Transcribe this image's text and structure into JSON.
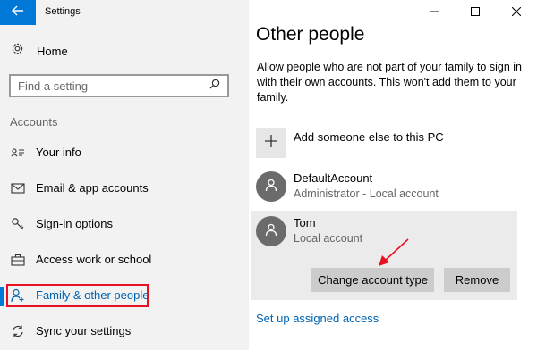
{
  "window": {
    "title": "Settings",
    "accent": "#0078d7",
    "highlight_color": "#e81123"
  },
  "sidebar": {
    "home_label": "Home",
    "search_placeholder": "Find a setting",
    "section_label": "Accounts",
    "items": [
      {
        "label": "Your info",
        "icon": "person-card-icon"
      },
      {
        "label": "Email & app accounts",
        "icon": "envelope-icon"
      },
      {
        "label": "Sign-in options",
        "icon": "key-icon"
      },
      {
        "label": "Access work or school",
        "icon": "briefcase-icon"
      },
      {
        "label": "Family & other people",
        "icon": "person-add-icon",
        "active": true
      },
      {
        "label": "Sync your settings",
        "icon": "sync-icon"
      }
    ]
  },
  "main": {
    "title": "Other people",
    "description": "Allow people who are not part of your family to sign in with their own accounts. This won't add them to your family.",
    "add_label": "Add someone else to this PC",
    "accounts": [
      {
        "name": "DefaultAccount",
        "type": "Administrator - Local account"
      },
      {
        "name": "Tom",
        "type": "Local account"
      }
    ],
    "change_type_label": "Change account type",
    "remove_label": "Remove",
    "assigned_access_link": "Set up assigned access"
  }
}
